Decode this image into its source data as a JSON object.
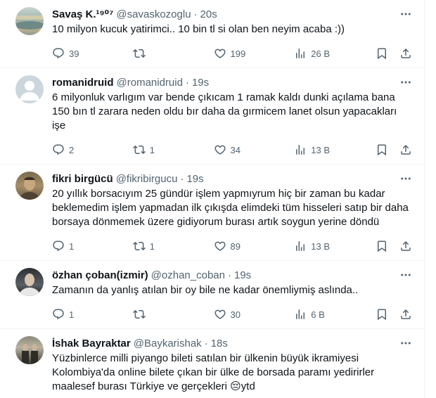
{
  "tweets": [
    {
      "name": "Savaş K.¹⁹⁰⁷",
      "handle": "@savaskozoglu",
      "time": "20s",
      "text": "10 milyon kucuk yatirimci.. 10 bin tl si olan ben neyim acaba :))",
      "replies": "39",
      "retweets": "",
      "likes": "199",
      "views": "26 B"
    },
    {
      "name": "romanidruid",
      "handle": "@romanidruid",
      "time": "19s",
      "text": "6 milyonluk varlıgım var bende çıkıcam 1 ramak kaldı dunki açılama  bana 150 bın tl zarara neden oldu bır daha da gırmicem lanet olsun yapacakları işe",
      "replies": "2",
      "retweets": "1",
      "likes": "34",
      "views": "13 B"
    },
    {
      "name": "fikri birgücü",
      "handle": "@fikribirgucu",
      "time": "19s",
      "text": "20 yıllık borsacıyım 25 gündür işlem yapmıyrum hiç bir zaman bu kadar beklemedim işlem yapmadan ilk çıkışda elimdeki tüm hisseleri satıp bir daha borsaya dönmemek üzere gidiyorum burası artık soygun yerine döndü",
      "replies": "1",
      "retweets": "1",
      "likes": "89",
      "views": "13 B"
    },
    {
      "name": "özhan çoban(izmir)",
      "handle": "@ozhan_coban",
      "time": "19s",
      "text": "Zamanın da yanlış atılan bir oy bile ne kadar önemliymiş aslında..",
      "replies": "1",
      "retweets": "",
      "likes": "30",
      "views": "6 B"
    },
    {
      "name": "İshak Bayraktar",
      "handle": "@Baykarishak",
      "time": "18s",
      "text": "Yüzbinlerce milli piyango bileti satılan bir ülkenin büyük ikramiyesi Kolombiya'da online bilete çıkan bir ülke de borsada paramı yedirirler maalesef burası Türkiye ve gerçekleri 😔ytd",
      "replies": "",
      "retweets": "",
      "likes": "",
      "views": ""
    }
  ],
  "separator": "·",
  "icons": {
    "more": "more-dots-icon",
    "reply": "reply-icon",
    "retweet": "retweet-icon",
    "like": "heart-icon",
    "views": "views-chart-icon",
    "bookmark": "bookmark-icon",
    "share": "share-icon"
  },
  "colors": {
    "text": "#0f1419",
    "secondary": "#536471",
    "border": "#eff3f4"
  }
}
